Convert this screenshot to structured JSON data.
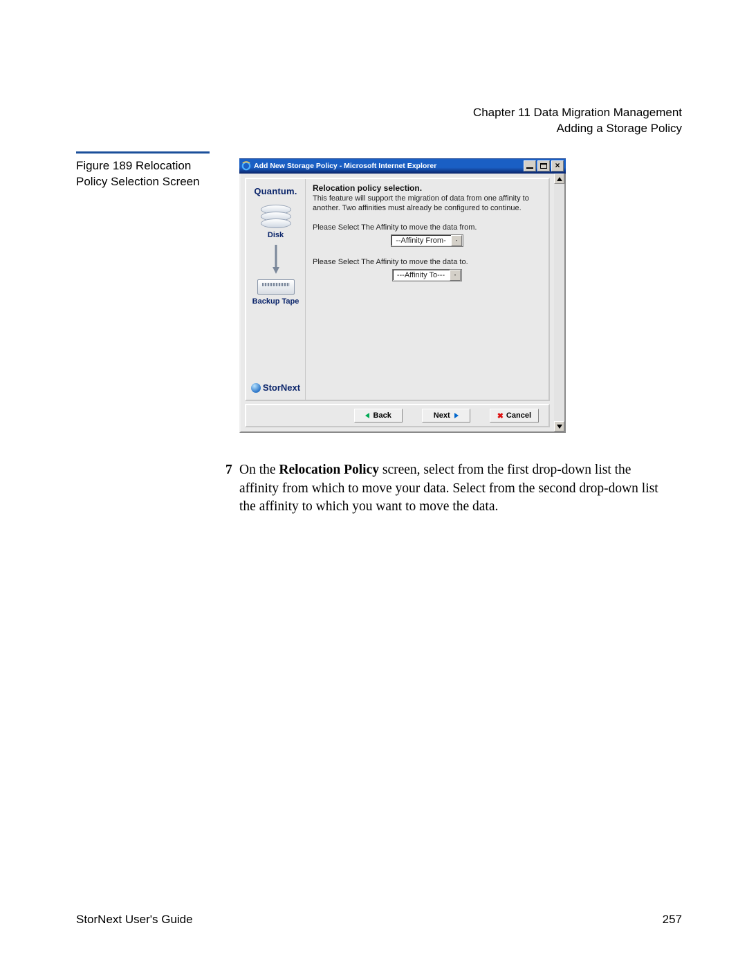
{
  "header": {
    "line1": "Chapter 11  Data Migration Management",
    "line2": "Adding a Storage Policy"
  },
  "figure_caption": "Figure 189  Relocation Policy Selection Screen",
  "window": {
    "title": "Add New Storage Policy - Microsoft Internet Explorer",
    "sidebar": {
      "brand": "Quantum.",
      "disk_label": "Disk",
      "tape_label": "Backup Tape",
      "product": "StorNext"
    },
    "main": {
      "heading": "Relocation policy selection.",
      "desc": "This feature will support the migration of data from one affinity to another. Two affinities must already be configured to continue.",
      "from_label": "Please Select The Affinity to move the data from.",
      "to_label": "Please Select The Affinity to move the data to.",
      "from_dd": "--Affinity From-",
      "to_dd": "---Affinity To---"
    },
    "buttons": {
      "back": "Back",
      "next": "Next",
      "cancel": "Cancel"
    }
  },
  "step": {
    "number": "7",
    "text_pre": "On the ",
    "text_bold": "Relocation Policy",
    "text_post": " screen, select from the first drop-down list the affinity from which to move your data. Select from the second drop-down list the affinity to which you want to move the data."
  },
  "footer": {
    "left": "StorNext User's Guide",
    "right": "257"
  }
}
